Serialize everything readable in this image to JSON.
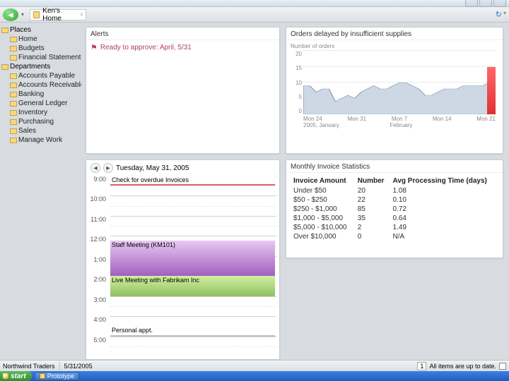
{
  "breadcrumb": {
    "label": "Ken's Home"
  },
  "sidebar": {
    "sections": [
      {
        "label": "Places",
        "children": [
          {
            "label": "Home"
          },
          {
            "label": "Budgets"
          },
          {
            "label": "Financial Statements"
          }
        ]
      },
      {
        "label": "Departments",
        "children": [
          {
            "label": "Accounts Payable"
          },
          {
            "label": "Accounts Receivable"
          },
          {
            "label": "Banking"
          },
          {
            "label": "General Ledger"
          },
          {
            "label": "Inventory"
          },
          {
            "label": "Purchasing"
          },
          {
            "label": "Sales"
          },
          {
            "label": "Manage Work"
          }
        ]
      }
    ]
  },
  "alerts": {
    "title": "Alerts",
    "items": [
      {
        "text": "Ready to approve: April, 5/31"
      }
    ]
  },
  "orders_chart": {
    "title": "Orders delayed by insufficient supplies",
    "ylabel": "Number of orders"
  },
  "chart_data": {
    "type": "area",
    "title": "Orders delayed by insufficient supplies",
    "ylabel": "Number of orders",
    "xlabel": "",
    "ylim": [
      0,
      20
    ],
    "x_ticks": [
      "Mon 24",
      "Mon 31",
      "Mon 7",
      "Mon 14",
      "Mon 21"
    ],
    "x_sub": [
      "2005, January",
      "February"
    ],
    "series": [
      {
        "name": "delayed_orders",
        "type": "area",
        "values": [
          9,
          9,
          7,
          8,
          8,
          4,
          5,
          6,
          5,
          7,
          8,
          9,
          8,
          8,
          9,
          10,
          10,
          9,
          8,
          6,
          6,
          7,
          8,
          8,
          8,
          9,
          9,
          9,
          9,
          10,
          10
        ],
        "color": "#c8d4e0"
      },
      {
        "name": "current_bar",
        "type": "bar",
        "x": "Mon 21",
        "value": 15,
        "color": "#e03030"
      }
    ]
  },
  "calendar": {
    "date_label": "Tuesday, May 31, 2005",
    "hours": [
      "9:00",
      "10:00",
      "11:00",
      "12:00",
      "1:00",
      "2:00",
      "3:00",
      "4:00",
      "5:00"
    ],
    "events": [
      {
        "title": "Check for overdue Invoices",
        "start": 9.0,
        "end": 9.5,
        "color": "#fff",
        "border": "#e06060"
      },
      {
        "title": "Staff Meeting (KM101)",
        "start": 12.25,
        "end": 14.0,
        "color": "linear-gradient(#e8c8f0,#a060c0)"
      },
      {
        "title": "Live Meeting with Fabrikam Inc",
        "start": 14.0,
        "end": 15.0,
        "color": "linear-gradient(#d0f0a0,#90c060)"
      },
      {
        "title": "Personal appt.",
        "start": 16.5,
        "end": 17.0,
        "color": "#fff",
        "border": "#c0c0c0"
      }
    ]
  },
  "stats": {
    "title": "Monthly Invoice Statistics",
    "headers": [
      "Invoice Amount",
      "Number",
      "Avg Processing Time (days)"
    ],
    "rows": [
      [
        "Under $50",
        "20",
        "1.08"
      ],
      [
        "$50 - $250",
        "22",
        "0.10"
      ],
      [
        "$250 - $1,000",
        "85",
        "0.72"
      ],
      [
        "$1,000 - $5,000",
        "35",
        "0.64"
      ],
      [
        "$5,000 - $10,000",
        "2",
        "1.49"
      ],
      [
        "Over $10,000",
        "0",
        "N/A"
      ]
    ]
  },
  "statusbar": {
    "left1": "Northwind Traders",
    "left2": "5/31/2005",
    "right_count": "1",
    "right_text": "All items are up to date."
  },
  "taskbar": {
    "start": "start",
    "task1": "Prototype"
  }
}
